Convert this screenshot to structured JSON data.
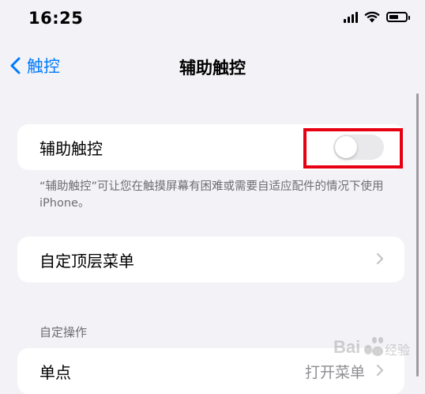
{
  "status_bar": {
    "time": "16:25",
    "icons": [
      "cellular-signal-icon",
      "wifi-icon",
      "battery-icon"
    ]
  },
  "nav": {
    "back_label": "触控",
    "title": "辅助触控"
  },
  "toggle_row": {
    "label": "辅助触控",
    "enabled": false,
    "footer": "“辅助触控”可让您在触摸屏幕有困难或需要自适应配件的情况下使用 iPhone。"
  },
  "menu_row": {
    "label": "自定顶层菜单"
  },
  "custom_actions": {
    "header": "自定操作",
    "rows": [
      {
        "label": "单点",
        "value": "打开菜单"
      }
    ]
  },
  "watermark": {
    "text": "Bai 经验"
  },
  "colors": {
    "accent": "#007aff",
    "background": "#f2f2f7",
    "highlight": "#e60012",
    "toggle_off": "#e9e9eb"
  }
}
